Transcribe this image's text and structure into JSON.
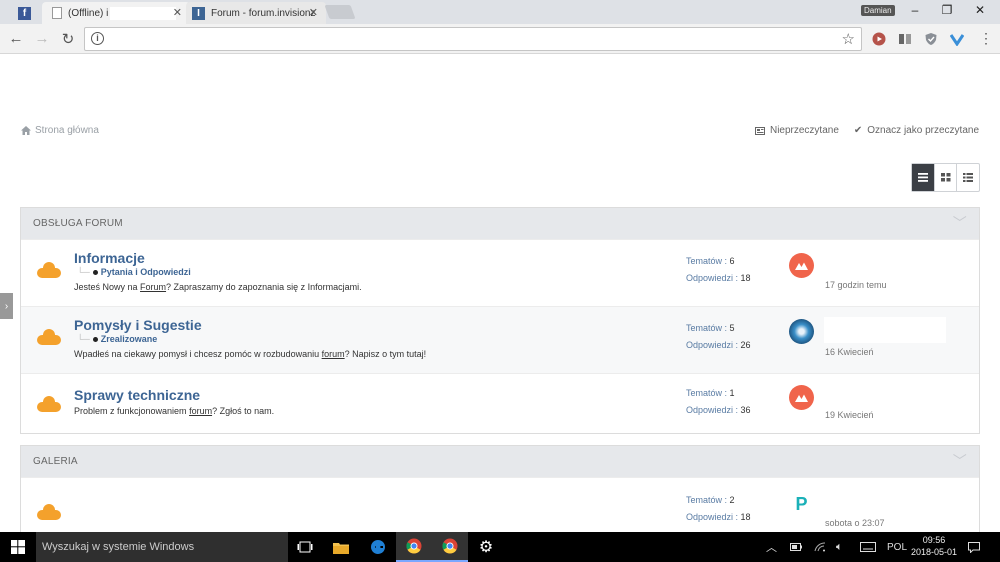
{
  "browser": {
    "tabs": [
      {
        "title": "(Offline) i",
        "active": true
      },
      {
        "title": "Forum - forum.invisionz",
        "active": false
      }
    ],
    "user": "Damian",
    "address": ""
  },
  "page": {
    "breadcrumb": "Strona główna",
    "unread_link": "Nieprzeczytane",
    "mark_read_link": "Oznacz jako przeczytane"
  },
  "categories": [
    {
      "title": "OBSŁUGA FORUM",
      "forums": [
        {
          "title": "Informacje",
          "subforum": "Pytania i Odpowiedzi",
          "desc_pre": "Jesteś Nowy na ",
          "desc_link": "Forum",
          "desc_post": "? Zapraszamy do zapoznania się z Informacjami.",
          "topics_label": "Tematów : ",
          "topics": "6",
          "replies_label": "Odpowiedzi : ",
          "replies": "18",
          "last_time": "17 godzin temu"
        },
        {
          "title": "Pomysły i Sugestie",
          "subforum": "Zrealizowane",
          "desc_pre": "Wpadłeś na ciekawy pomysł i chcesz pomóc w rozbudowaniu ",
          "desc_link": "forum",
          "desc_post": "? Napisz o tym tutaj!",
          "topics_label": "Tematów : ",
          "topics": "5",
          "replies_label": "Odpowiedzi : ",
          "replies": "26",
          "last_time": "16 Kwiecień"
        },
        {
          "title": "Sprawy techniczne",
          "desc_pre": "Problem z funkcjonowaniem ",
          "desc_link": "forum",
          "desc_post": "? Zgłoś to nam.",
          "topics_label": "Tematów : ",
          "topics": "1",
          "replies_label": "Odpowiedzi : ",
          "replies": "36",
          "last_time": "19 Kwiecień"
        }
      ]
    },
    {
      "title": "GALERIA",
      "forums": [
        {
          "topics_label": "Tematów : ",
          "topics": "2",
          "replies_label": "Odpowiedzi : ",
          "replies": "18",
          "last_time": "sobota o 23:07"
        }
      ]
    }
  ],
  "taskbar": {
    "search_placeholder": "Wyszukaj w systemie Windows",
    "language": "POL",
    "time": "09:56",
    "date": "2018-05-01"
  },
  "colors": {
    "accent": "#3d6594",
    "forum_icon": "#f4a12c"
  }
}
